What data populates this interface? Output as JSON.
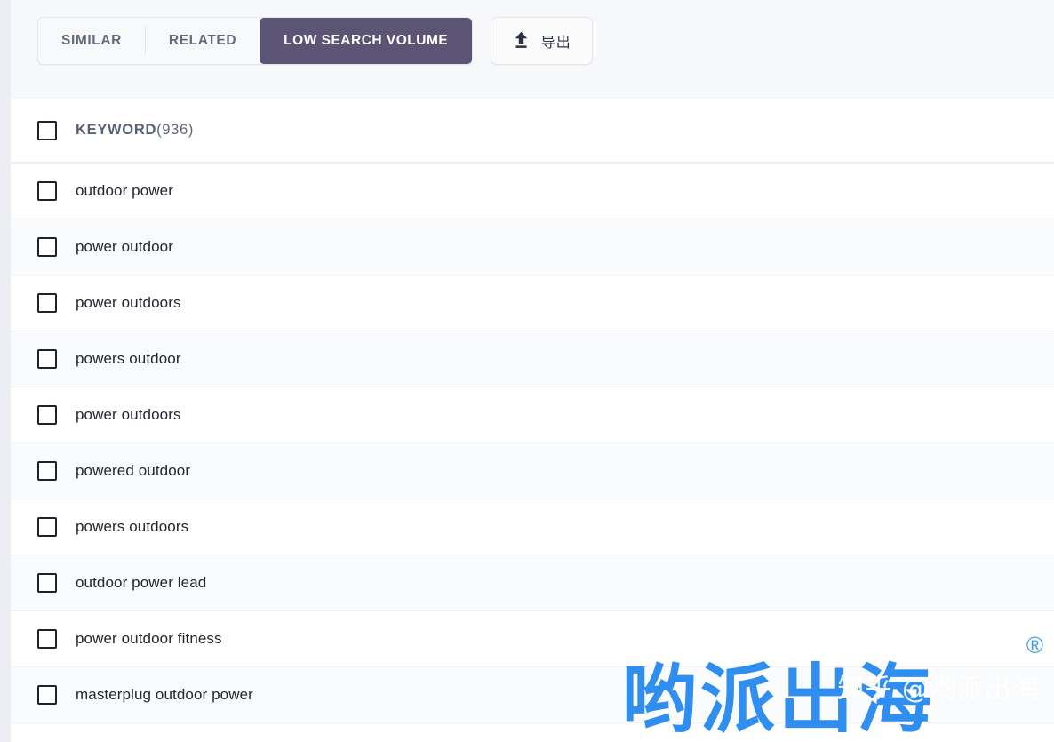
{
  "colors": {
    "page_background": "#eceef3",
    "panel_background": "#ffffff",
    "toolbar_background": "#f7f8fa",
    "active_tab": "#5b5474",
    "active_tab_text": "#ffffff",
    "inactive_tab_text": "#636b7d",
    "row_alt_background": "#fafbfc",
    "row_text": "#22262e",
    "header_text": "#5e6678",
    "checkbox_border": "#1d222b",
    "export_icon": "#2c3245",
    "watermark_blue": "#2f8ef0"
  },
  "toolbar": {
    "tabs": [
      {
        "label": "SIMILAR",
        "active": false,
        "name": "tab-similar"
      },
      {
        "label": "RELATED",
        "active": false,
        "name": "tab-related"
      },
      {
        "label": "LOW SEARCH VOLUME",
        "active": true,
        "name": "tab-low-search-volume"
      }
    ],
    "export": {
      "label": "导出",
      "icon": "upload-icon"
    }
  },
  "list": {
    "header": {
      "title": "KEYWORD",
      "count": "(936)",
      "checkbox_checked": false
    },
    "rows": [
      {
        "keyword": "outdoor power",
        "checked": false
      },
      {
        "keyword": "power outdoor",
        "checked": false
      },
      {
        "keyword": "power outdoors",
        "checked": false
      },
      {
        "keyword": "powers outdoor",
        "checked": false
      },
      {
        "keyword": "power outdoors",
        "checked": false
      },
      {
        "keyword": "powered outdoor",
        "checked": false
      },
      {
        "keyword": "powers outdoors",
        "checked": false
      },
      {
        "keyword": "outdoor power lead",
        "checked": false
      },
      {
        "keyword": "power outdoor fitness",
        "checked": false
      },
      {
        "keyword": "masterplug outdoor power",
        "checked": false
      }
    ]
  },
  "watermark": {
    "logo_text": "哟派出海",
    "registered_mark": "®",
    "overlay_text": "知乎 @哟派出海"
  }
}
